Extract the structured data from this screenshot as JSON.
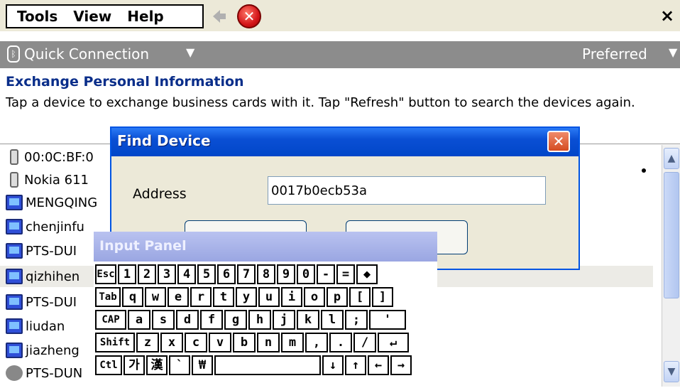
{
  "menu": {
    "tools": "Tools",
    "view": "View",
    "help": "Help",
    "close": "×"
  },
  "toolbar": {
    "quick_connection": "Quick Connection",
    "quick_caret": "▼",
    "preferred": "Preferred",
    "preferred_caret": "▼"
  },
  "heading": "Exchange Personal Information",
  "description": "Tap a device to exchange business cards with it. Tap \"Refresh\" button to search the devices again.",
  "devices": [
    {
      "label": "00:0C:BF:0",
      "icon": "phone-icon"
    },
    {
      "label": "Nokia 611",
      "icon": "phone-icon"
    },
    {
      "label": "MENGQING",
      "icon": "computer-icon"
    },
    {
      "label": "chenjinfu",
      "icon": "computer-icon"
    },
    {
      "label": "PTS-DUI",
      "icon": "computer-icon"
    },
    {
      "label": "qizhihen",
      "icon": "computer-icon"
    },
    {
      "label": "PTS-DUI",
      "icon": "computer-icon"
    },
    {
      "label": "liudan",
      "icon": "computer-icon"
    },
    {
      "label": "jiazheng",
      "icon": "computer-icon"
    },
    {
      "label": "PTS-DUN",
      "icon": "device-icon"
    }
  ],
  "find_dialog": {
    "title": "Find Device",
    "close": "✕",
    "address_label": "Address",
    "address_value": "0017b0ecb53a"
  },
  "input_panel": {
    "title": "Input Panel"
  },
  "keyboard": {
    "row1": [
      "Esc",
      "1",
      "2",
      "3",
      "4",
      "5",
      "6",
      "7",
      "8",
      "9",
      "0",
      "-",
      "=",
      "◆"
    ],
    "row2": [
      "Tab",
      "q",
      "w",
      "e",
      "r",
      "t",
      "y",
      "u",
      "i",
      "o",
      "p",
      "[",
      "]"
    ],
    "row3": [
      "CAP",
      "a",
      "s",
      "d",
      "f",
      "g",
      "h",
      "j",
      "k",
      "l",
      ";",
      "'"
    ],
    "row4": [
      "Shift",
      "z",
      "x",
      "c",
      "v",
      "b",
      "n",
      "m",
      ",",
      ".",
      "/",
      "↵"
    ],
    "row5": [
      "Ctl",
      "가",
      "漢",
      "`",
      "₩",
      "",
      "↓",
      "↑",
      "←",
      "→"
    ]
  },
  "scroll": {
    "up": "▲",
    "down": "▼"
  }
}
